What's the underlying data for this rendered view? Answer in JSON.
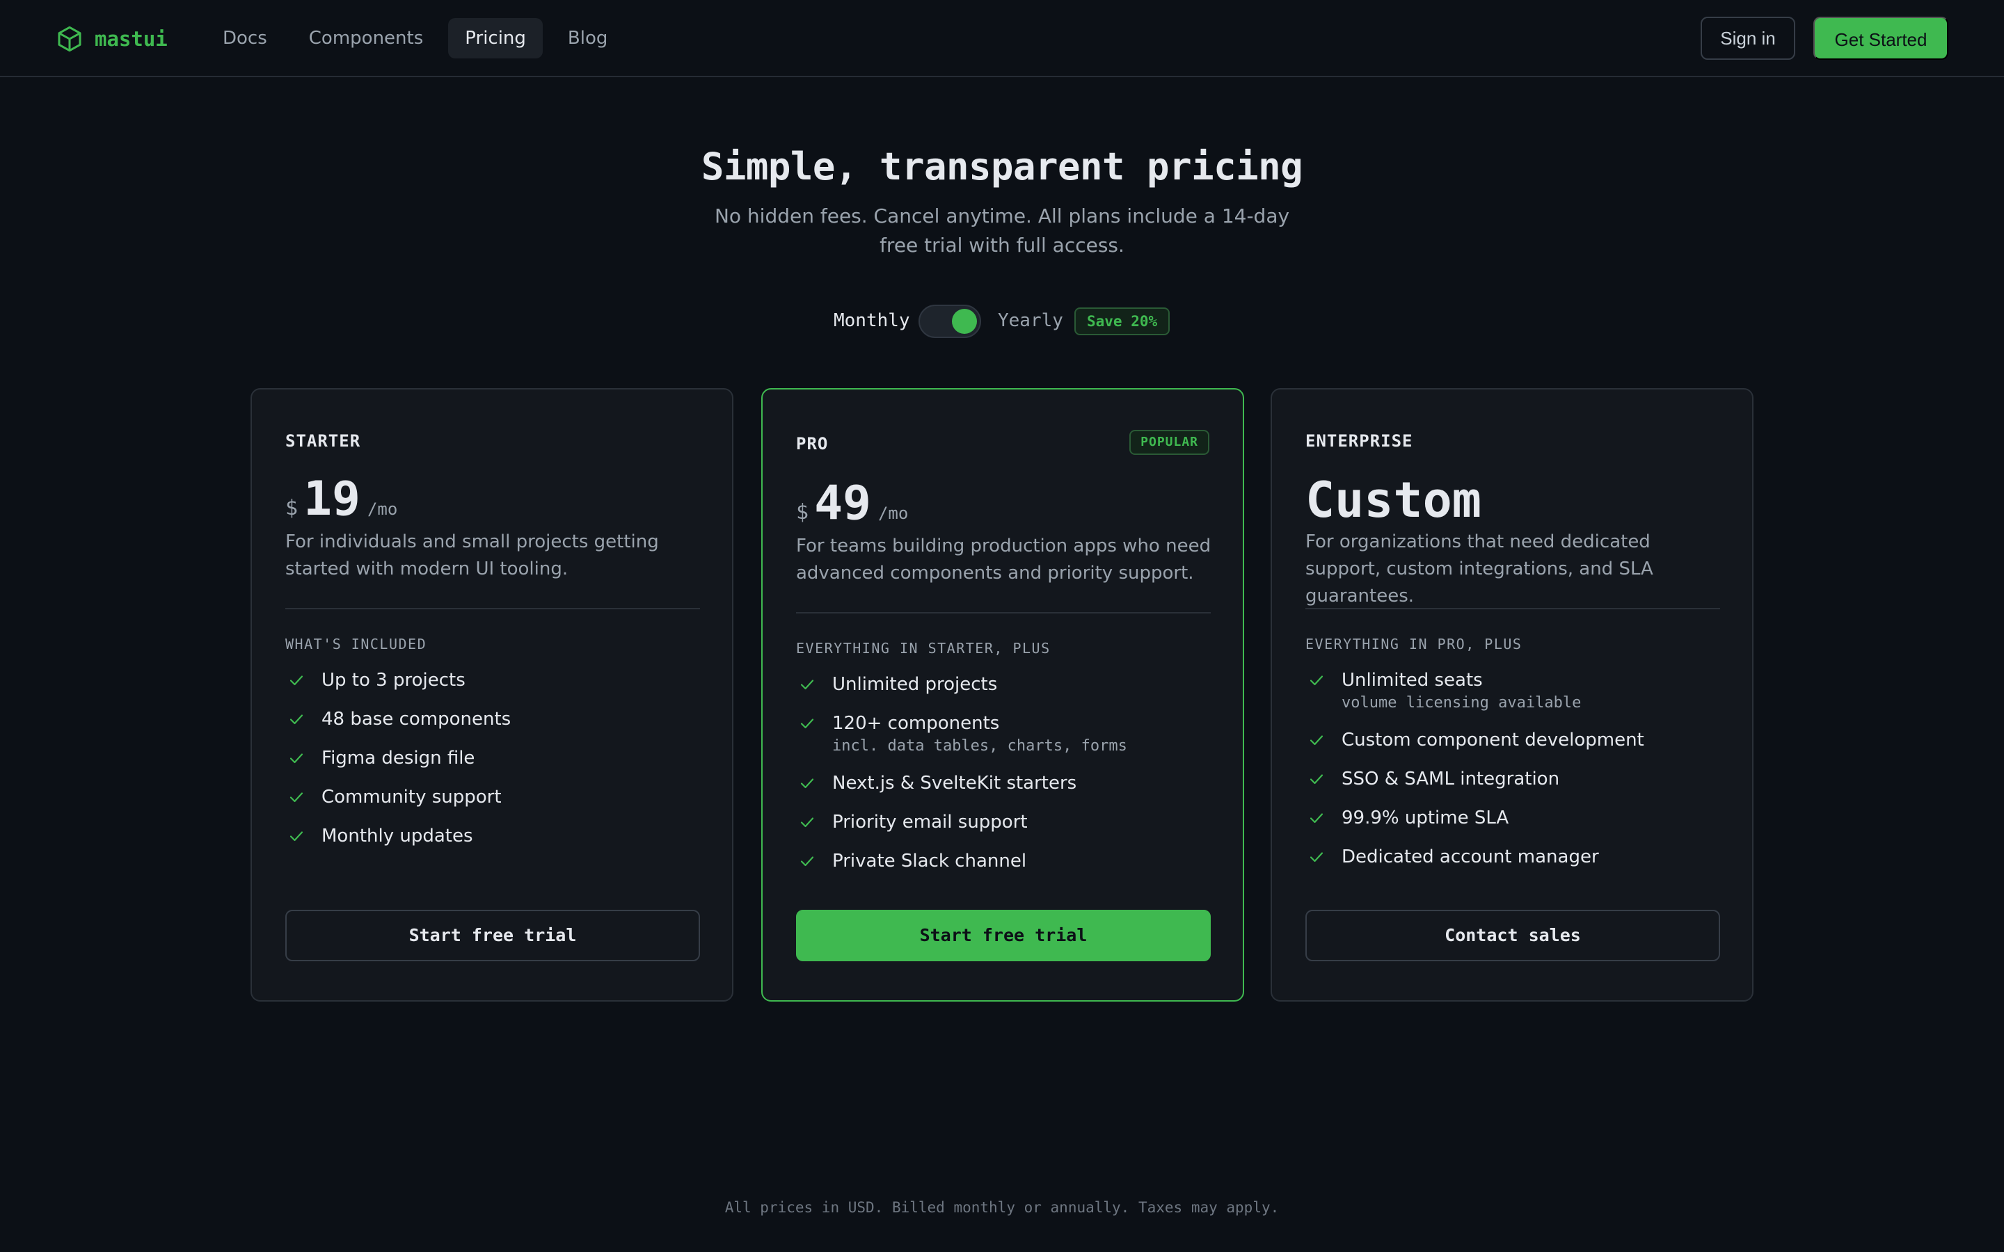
{
  "brand": {
    "name": "mastui",
    "accent": "#3fb950",
    "logo_icon": "cube-icon"
  },
  "nav": {
    "links": [
      {
        "label": "Docs",
        "active": false
      },
      {
        "label": "Components",
        "active": false
      },
      {
        "label": "Pricing",
        "active": true
      },
      {
        "label": "Blog",
        "active": false
      }
    ],
    "sign_in": "Sign in",
    "get_started": "Get Started"
  },
  "hero": {
    "title": "Simple, transparent pricing",
    "subtitle": "No hidden fees. Cancel anytime. All plans include a 14-day free trial with full access."
  },
  "billing_toggle": {
    "monthly_label": "Monthly",
    "yearly_label": "Yearly",
    "save_badge": "Save 20%",
    "selected": "yearly"
  },
  "plans": [
    {
      "name": "STARTER",
      "currency": "$",
      "price": "19",
      "period": "/mo",
      "description": "For individuals and small projects getting started with modern UI tooling.",
      "included_label": "WHAT'S INCLUDED",
      "features": [
        {
          "text": "Up to 3 projects",
          "sub": ""
        },
        {
          "text": "48 base components",
          "sub": ""
        },
        {
          "text": "Figma design file",
          "sub": ""
        },
        {
          "text": "Community support",
          "sub": ""
        },
        {
          "text": "Monthly updates",
          "sub": ""
        }
      ],
      "cta": "Start free trial"
    },
    {
      "name": "PRO",
      "badge": "POPULAR",
      "currency": "$",
      "price": "49",
      "period": "/mo",
      "description": "For teams building production apps who need advanced components and priority support.",
      "included_label": "EVERYTHING IN STARTER, PLUS",
      "features": [
        {
          "text": "Unlimited projects",
          "sub": ""
        },
        {
          "text": "120+ components",
          "sub": "incl. data tables, charts, forms"
        },
        {
          "text": "Next.js & SvelteKit starters",
          "sub": ""
        },
        {
          "text": "Priority email support",
          "sub": ""
        },
        {
          "text": "Private Slack channel",
          "sub": ""
        }
      ],
      "cta": "Start free trial"
    },
    {
      "name": "ENTERPRISE",
      "price": "Custom",
      "description": "For organizations that need dedicated support, custom integrations, and SLA guarantees.",
      "included_label": "EVERYTHING IN PRO, PLUS",
      "features": [
        {
          "text": "Unlimited seats",
          "sub": "volume licensing available"
        },
        {
          "text": "Custom component development",
          "sub": ""
        },
        {
          "text": "SSO & SAML integration",
          "sub": ""
        },
        {
          "text": "99.9% uptime SLA",
          "sub": ""
        },
        {
          "text": "Dedicated account manager",
          "sub": ""
        }
      ],
      "cta": "Contact sales"
    }
  ],
  "footer_note": "All prices in USD. Billed monthly or annually. Taxes may apply."
}
